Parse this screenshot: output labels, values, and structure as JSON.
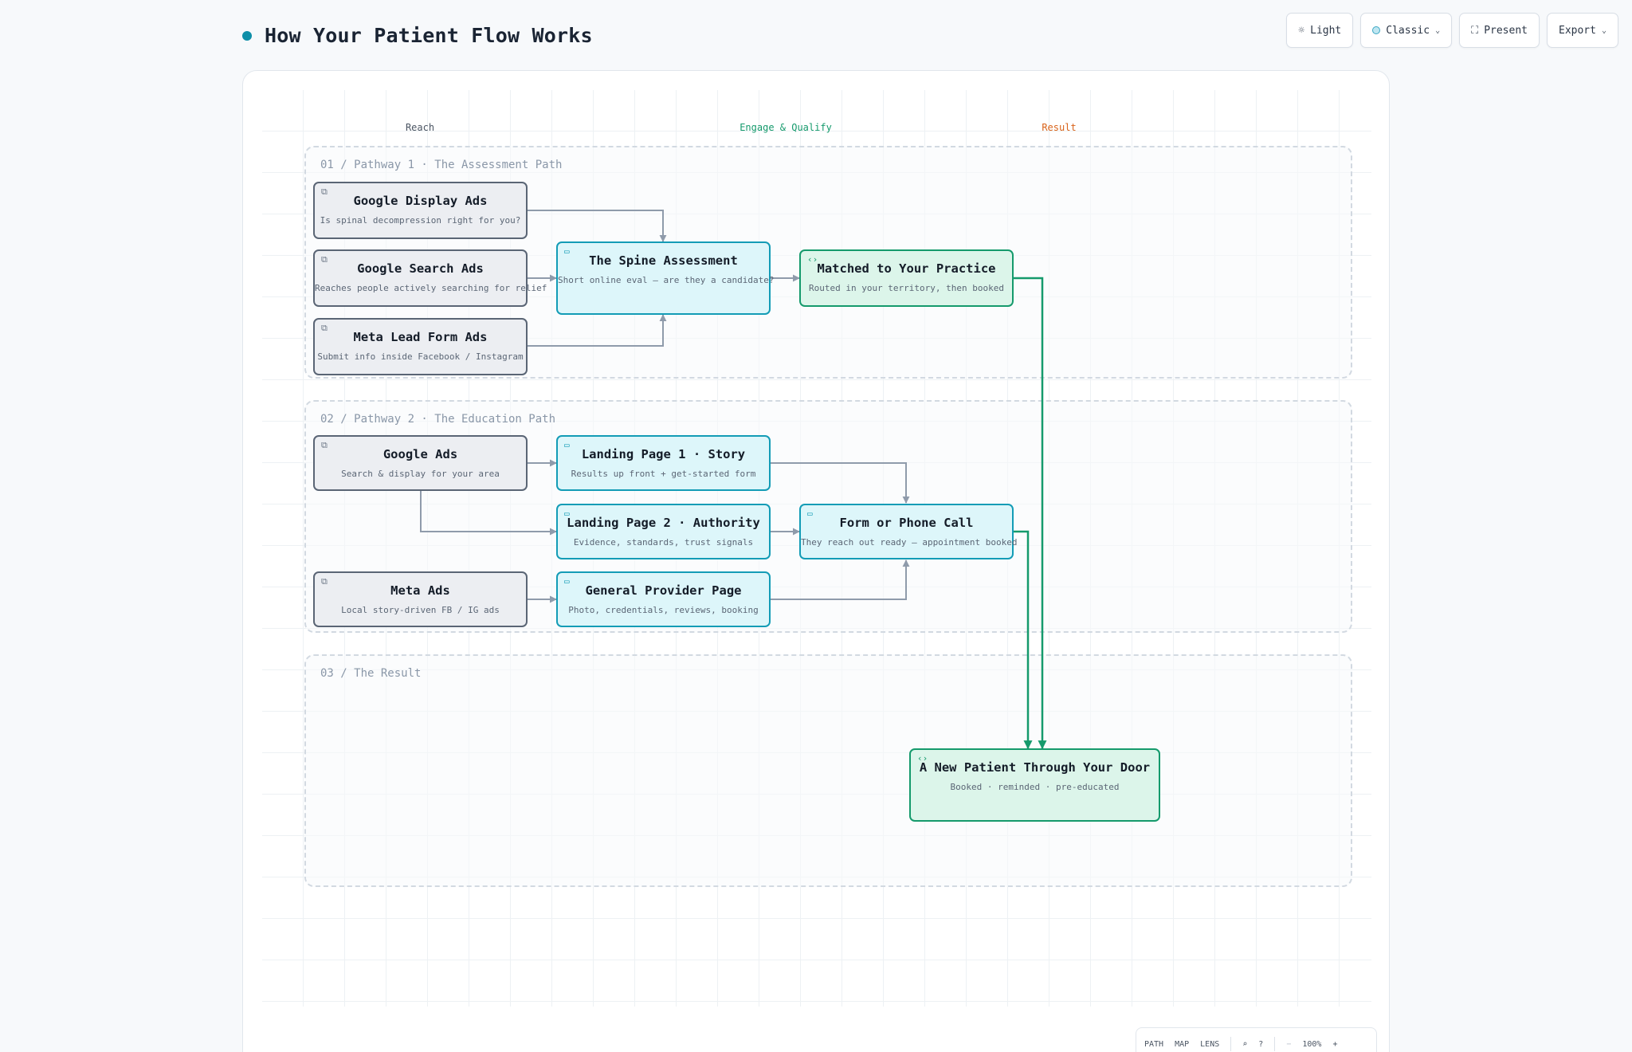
{
  "header": {
    "title": "How Your Patient Flow Works",
    "accent_color": "#0e8fa8"
  },
  "toolbar": {
    "theme_label": "Light",
    "theme_icon": "sun-icon",
    "style_label": "Classic",
    "present_label": "Present",
    "present_icon": "expand-icon",
    "export_label": "Export"
  },
  "columns": {
    "reach": {
      "label": "Reach",
      "color": "#4b5563"
    },
    "engage": {
      "label": "Engage & Qualify",
      "color": "#159a6c"
    },
    "result": {
      "label": "Result",
      "color": "#d9631a"
    }
  },
  "lanes": [
    {
      "title": "01 / Pathway 1 · The Assessment Path"
    },
    {
      "title": "02 / Pathway 2 · The Education Path"
    },
    {
      "title": "03 / The Result"
    }
  ],
  "nodes": {
    "google_display": {
      "title": "Google Display Ads",
      "subtitle": "Is spinal decompression right for you?",
      "icon": "external-link-icon"
    },
    "google_search": {
      "title": "Google Search Ads",
      "subtitle": "Reaches people actively searching for relief",
      "icon": "external-link-icon"
    },
    "meta_lead": {
      "title": "Meta Lead Form Ads",
      "subtitle": "Submit info inside Facebook / Instagram",
      "icon": "external-link-icon"
    },
    "spine_assessment": {
      "title": "The Spine Assessment",
      "subtitle": "Short online eval — are they a candidate?",
      "icon": "browser-window-icon"
    },
    "matched": {
      "title": "Matched to Your Practice",
      "subtitle": "Routed in your territory, then booked",
      "icon": "code-brackets-icon"
    },
    "google_ads": {
      "title": "Google Ads",
      "subtitle": "Search & display for your area",
      "icon": "external-link-icon"
    },
    "landing_1": {
      "title": "Landing Page 1 · Story",
      "subtitle": "Results up front + get-started form",
      "icon": "browser-window-icon"
    },
    "landing_2": {
      "title": "Landing Page 2 · Authority",
      "subtitle": "Evidence, standards, trust signals",
      "icon": "browser-window-icon"
    },
    "form_call": {
      "title": "Form or Phone Call",
      "subtitle": "They reach out ready — appointment booked",
      "icon": "browser-window-icon"
    },
    "meta_ads": {
      "title": "Meta Ads",
      "subtitle": "Local story-driven FB / IG ads",
      "icon": "external-link-icon"
    },
    "provider_page": {
      "title": "General Provider Page",
      "subtitle": "Photo, credentials, reviews, booking",
      "icon": "browser-window-icon"
    },
    "new_patient": {
      "title": "A New Patient Through Your Door",
      "subtitle": "Booked · reminded · pre-educated",
      "icon": "code-brackets-icon"
    }
  },
  "edges": [
    {
      "from": "google_display",
      "to": "spine_assessment",
      "color": "#8f9bab"
    },
    {
      "from": "google_search",
      "to": "spine_assessment",
      "color": "#8f9bab"
    },
    {
      "from": "meta_lead",
      "to": "spine_assessment",
      "color": "#8f9bab"
    },
    {
      "from": "spine_assessment",
      "to": "matched",
      "color": "#8f9bab"
    },
    {
      "from": "matched",
      "to": "new_patient",
      "color": "#159a6c"
    },
    {
      "from": "google_ads",
      "to": "landing_1",
      "color": "#8f9bab"
    },
    {
      "from": "google_ads",
      "to": "landing_2",
      "color": "#8f9bab"
    },
    {
      "from": "landing_1",
      "to": "form_call",
      "color": "#8f9bab"
    },
    {
      "from": "landing_2",
      "to": "form_call",
      "color": "#8f9bab"
    },
    {
      "from": "meta_ads",
      "to": "provider_page",
      "color": "#8f9bab"
    },
    {
      "from": "provider_page",
      "to": "form_call",
      "color": "#8f9bab"
    },
    {
      "from": "form_call",
      "to": "new_patient",
      "color": "#159a6c"
    }
  ],
  "zoombar": {
    "path_label": "PATH",
    "map_label": "MAP",
    "lens_label": "LENS",
    "search_icon": "search-icon",
    "help_icon": "help-icon",
    "zoom_out": "−",
    "zoom_level": "100%",
    "zoom_in": "+"
  }
}
